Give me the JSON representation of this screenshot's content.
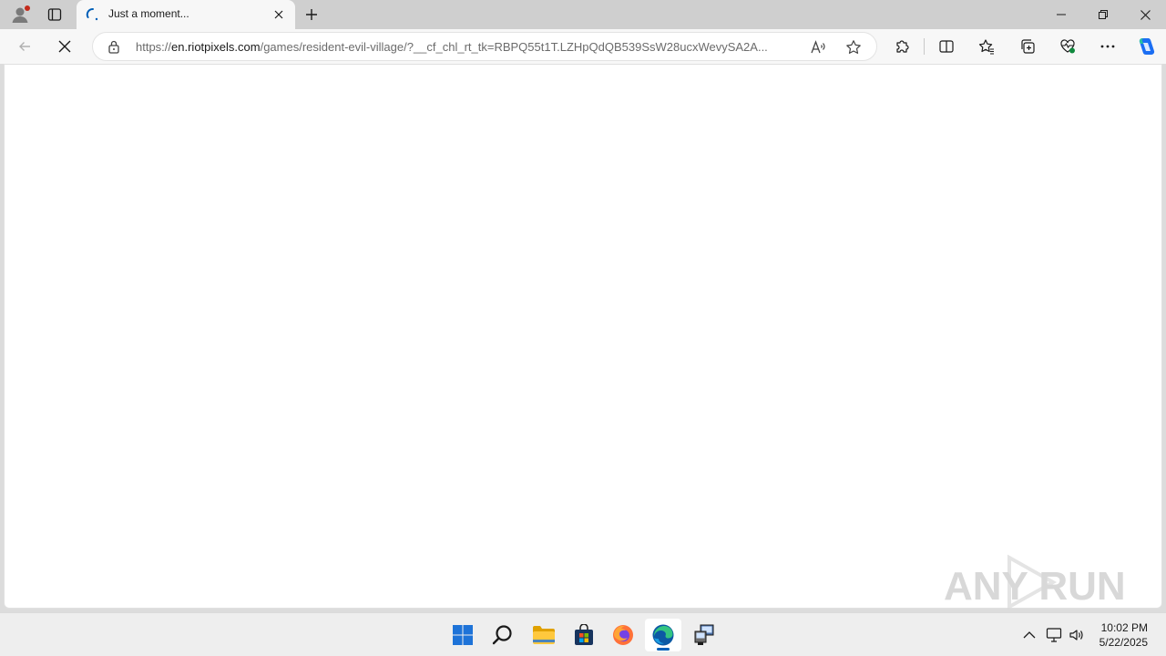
{
  "browser": {
    "tab": {
      "title": "Just a moment..."
    },
    "address_bar": {
      "url_prefix": "https://",
      "url_host": "en.riotpixels.com",
      "url_rest": "/games/resident-evil-village/?__cf_chl_rt_tk=RBPQ55t1T.LZHpQdQB539SsW28ucxWevySA2A..."
    },
    "loading": true
  },
  "watermark": {
    "text": "ANY RUN"
  },
  "taskbar": {
    "pinned": [
      "start-icon",
      "search-icon",
      "file-explorer-icon",
      "store-icon",
      "firefox-icon",
      "edge-icon",
      "network-tool-icon"
    ],
    "clock": {
      "time": "10:02 PM",
      "date": "5/22/2025"
    }
  },
  "colors": {
    "accent": "#005fb8",
    "copilot": "#1b6ef3"
  }
}
